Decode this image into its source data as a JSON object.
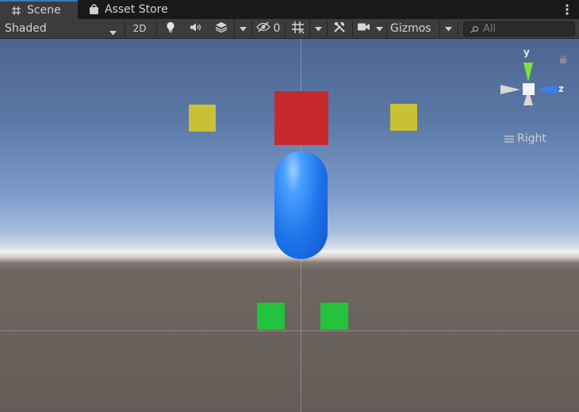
{
  "tabs": [
    {
      "label": "Scene",
      "icon": "grid-hash-icon",
      "active": true
    },
    {
      "label": "Asset Store",
      "icon": "shopping-bag-icon",
      "active": false
    }
  ],
  "toolbar": {
    "draw_mode": "Shaded",
    "mode_2d_label": "2D",
    "hidden_count": "0",
    "gizmos_label": "Gizmos",
    "search_placeholder": "All"
  },
  "viewport": {
    "gizmo": {
      "y_label": "y",
      "z_label": "z",
      "view_label": "Right"
    },
    "objects": [
      {
        "name": "red-cube",
        "color": "#c62a2f"
      },
      {
        "name": "yellow-cube-left",
        "color": "#c9c034"
      },
      {
        "name": "yellow-cube-right",
        "color": "#c9c034"
      },
      {
        "name": "blue-capsule",
        "color": "#1e74ea"
      },
      {
        "name": "green-cube-left",
        "color": "#23c33b"
      },
      {
        "name": "green-cube-right",
        "color": "#23c33b"
      }
    ]
  },
  "colors": {
    "accent": "#3a79bb",
    "axis_y": "#7ee23a",
    "axis_z": "#3f7cf2"
  }
}
